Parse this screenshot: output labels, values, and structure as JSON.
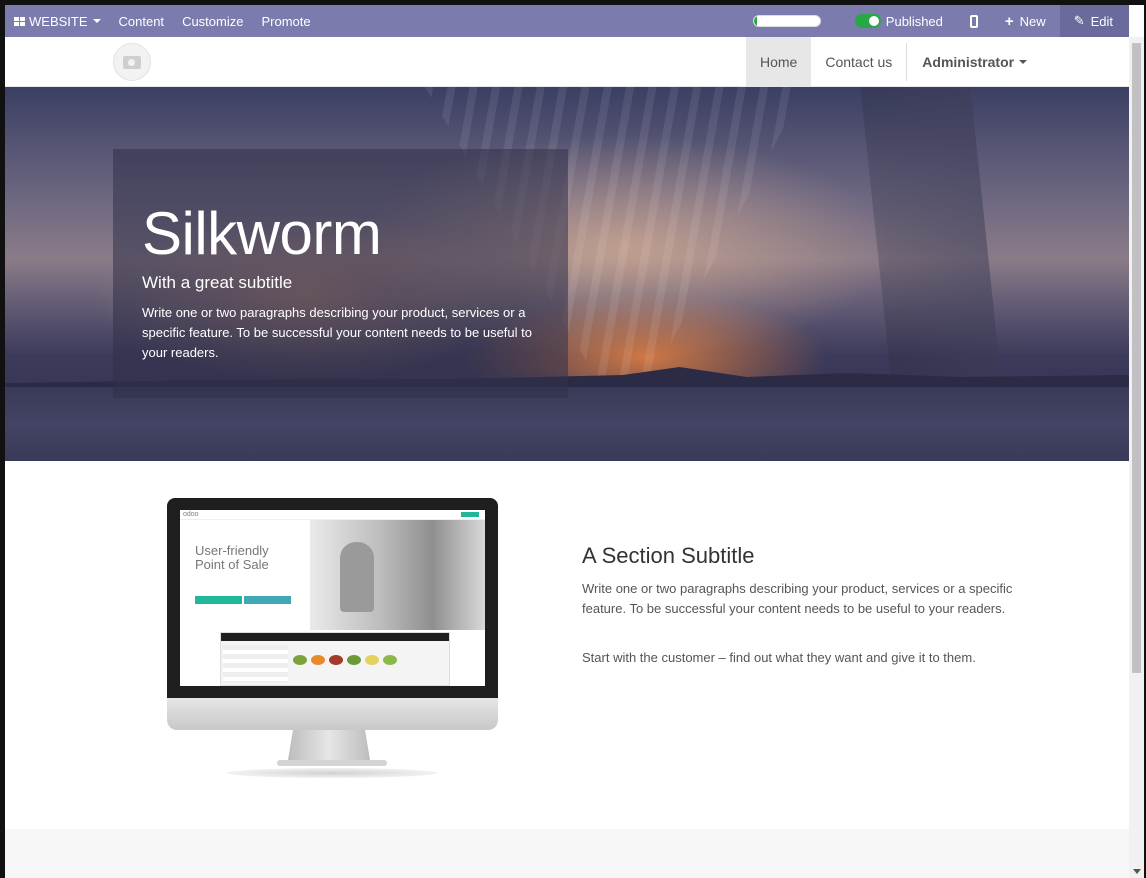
{
  "adminbar": {
    "website_label": "WEBSITE",
    "content_label": "Content",
    "customize_label": "Customize",
    "promote_label": "Promote",
    "progress_fraction": 0.05,
    "published_label": "Published",
    "new_label": "New",
    "edit_label": "Edit",
    "bar_color": "#7c7bad",
    "toggle_color": "#28a745"
  },
  "nav": {
    "home_label": "Home",
    "contact_label": "Contact us",
    "admin_label": "Administrator"
  },
  "hero": {
    "title": "Silkworm",
    "subtitle": "With a great subtitle",
    "text": "Write one or two paragraphs describing your product, services or a specific feature. To be successful your content needs to be useful to your readers."
  },
  "section": {
    "monitor_heading_line1": "User-friendly",
    "monitor_heading_line2": "Point of Sale",
    "monitor_logo": "odoo",
    "title": "A Section Subtitle",
    "text": "Write one or two paragraphs describing your product, services or a specific feature. To be successful your content needs to be useful to your readers.",
    "text2": "Start with the customer – find out what they want and give it to them."
  }
}
